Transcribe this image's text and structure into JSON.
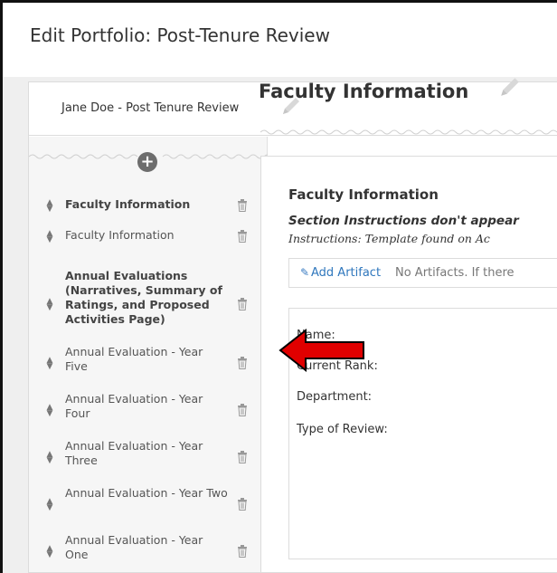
{
  "window": {
    "title": "Edit Portfolio: Post-Tenure Review"
  },
  "portfolio": {
    "name": "Jane Doe - Post Tenure Review"
  },
  "sidebar": {
    "add_label": "+",
    "items": [
      {
        "label": "Faculty Information",
        "bold": true
      },
      {
        "label": "Faculty Information",
        "bold": false
      },
      {
        "label": "Annual Evaluations (Narratives, Summary of Ratings, and Proposed Activities Page)",
        "bold": true
      },
      {
        "label": "Annual Evaluation - Year Five",
        "bold": false
      },
      {
        "label": "Annual Evaluation - Year Four",
        "bold": false
      },
      {
        "label": "Annual Evaluation - Year Three",
        "bold": false
      },
      {
        "label": "Annual Evaluation - Year Two",
        "bold": false
      },
      {
        "label": "Annual Evaluation - Year One",
        "bold": false
      }
    ]
  },
  "main": {
    "section_title": "Faculty Information",
    "panel_title": "Faculty Information",
    "instructions_note": "Section Instructions don't appear",
    "instructions_text": "Instructions: Template found on Ac",
    "add_artifact_label": "Add Artifact",
    "no_artifacts_text": "No Artifacts. If there",
    "fields": [
      "Name:",
      "Current Rank:",
      "Department:",
      "Type of Review:"
    ]
  },
  "colors": {
    "arrow": "#e00000",
    "link": "#2f77bd",
    "sidebar_bg": "#f6f6f6"
  },
  "icons": [
    "pencil-icon",
    "plus-circle-icon",
    "drag-handle-icon",
    "trash-icon",
    "paperclip-icon",
    "red-arrow"
  ]
}
